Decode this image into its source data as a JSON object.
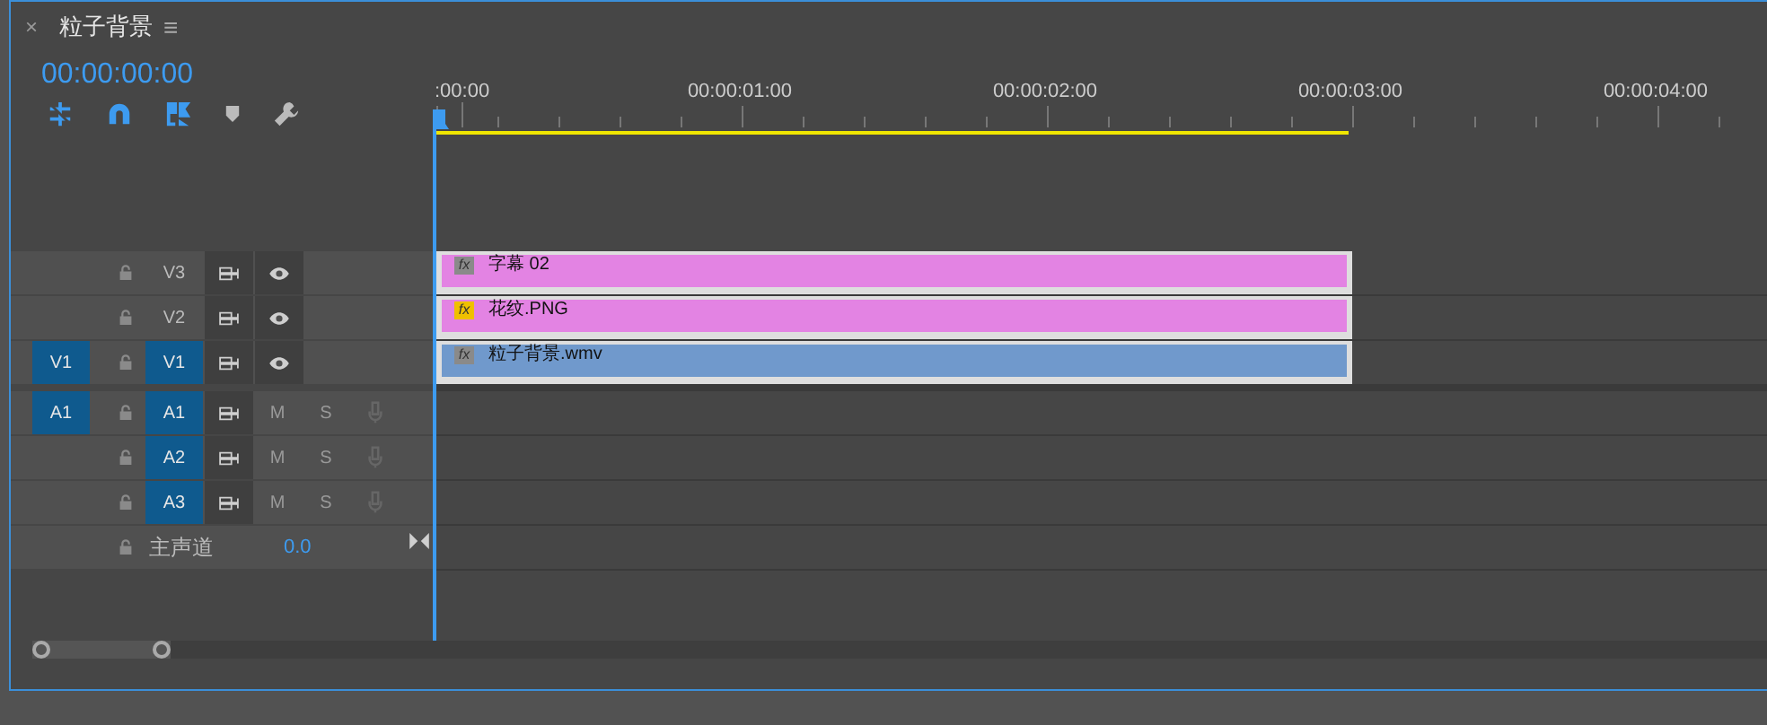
{
  "panel": {
    "close": "×",
    "title": "粒子背景",
    "menu": "≡"
  },
  "timecode": "00:00:00:00",
  "tools": [
    {
      "kind": "nest",
      "on": true
    },
    {
      "kind": "snap",
      "on": true
    },
    {
      "kind": "linked",
      "on": true
    },
    {
      "kind": "marker",
      "on": false
    },
    {
      "kind": "wrench",
      "on": false
    }
  ],
  "ruler": {
    "labels": [
      ":00:00",
      "00:00:01:00",
      "00:00:02:00",
      "00:00:03:00",
      "00:00:04:00"
    ]
  },
  "tracks": [
    {
      "kind": "video",
      "label": "V3",
      "targeted": false,
      "clip": {
        "name": "字幕 02",
        "color": "#e383e3",
        "fx": "fx",
        "fx_active": false
      }
    },
    {
      "kind": "video",
      "label": "V2",
      "targeted": false,
      "clip": {
        "name": "花纹.PNG",
        "color": "#e383e3",
        "fx": "fx",
        "fx_active": true
      }
    },
    {
      "kind": "video",
      "label": "V1",
      "source_patch": "V1",
      "targeted": true,
      "clip": {
        "name": "粒子背景.wmv",
        "color": "#7099cc",
        "fx": "fx",
        "fx_active": false
      }
    },
    {
      "kind": "audio",
      "label": "A1",
      "source_patch": "A1",
      "targeted": true,
      "mute": "M",
      "solo": "S"
    },
    {
      "kind": "audio",
      "label": "A2",
      "targeted": true,
      "mute": "M",
      "solo": "S"
    },
    {
      "kind": "audio",
      "label": "A3",
      "targeted": true,
      "mute": "M",
      "solo": "S"
    },
    {
      "kind": "master",
      "label": "主声道",
      "value": "0.0"
    }
  ]
}
